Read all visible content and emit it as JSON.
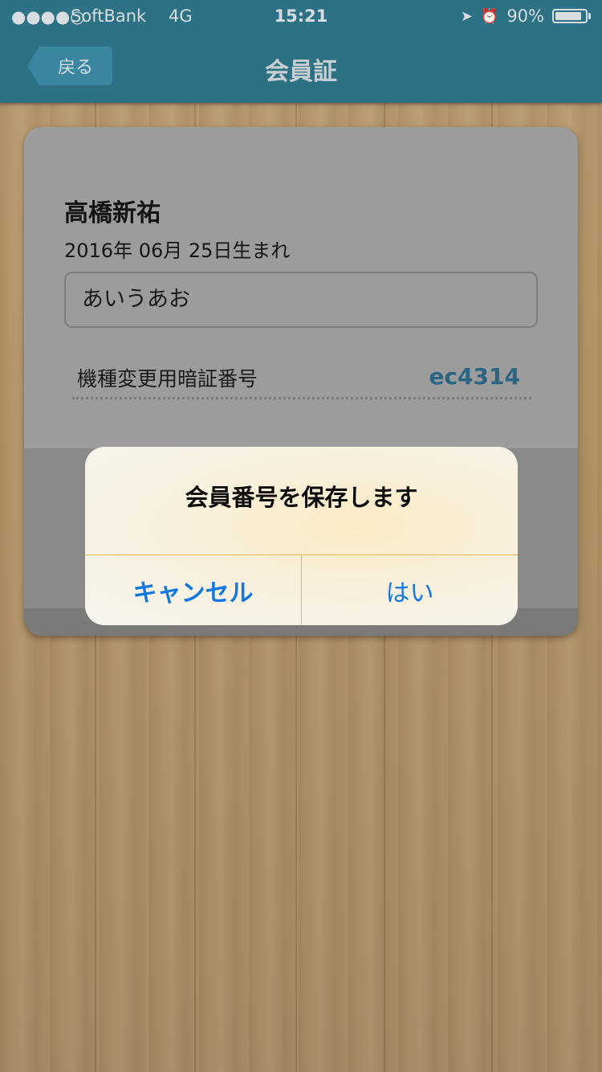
{
  "status_bar": {
    "signal": "●●●●○",
    "carrier": "SoftBank",
    "network": "4G",
    "time": "15:21",
    "location_icon": "➤",
    "alarm_icon": "⏰",
    "battery_level": "90%",
    "battery_fraction": 0.9
  },
  "nav": {
    "back_label": "戻る",
    "title": "会員証"
  },
  "card": {
    "name": "高橋新祐",
    "birth_date": "2016年 06月 25日生まれ",
    "text_field_value": "あいうあお",
    "pin_label": "機種変更用暗証番号",
    "pin_value": "ec4314"
  },
  "alert": {
    "title": "会員番号を保存します",
    "cancel_label": "キャンセル",
    "ok_label": "はい"
  },
  "colors": {
    "nav_bar": "#2c7184",
    "accent_blue": "#1377e0",
    "pin_value": "#2a6684"
  }
}
